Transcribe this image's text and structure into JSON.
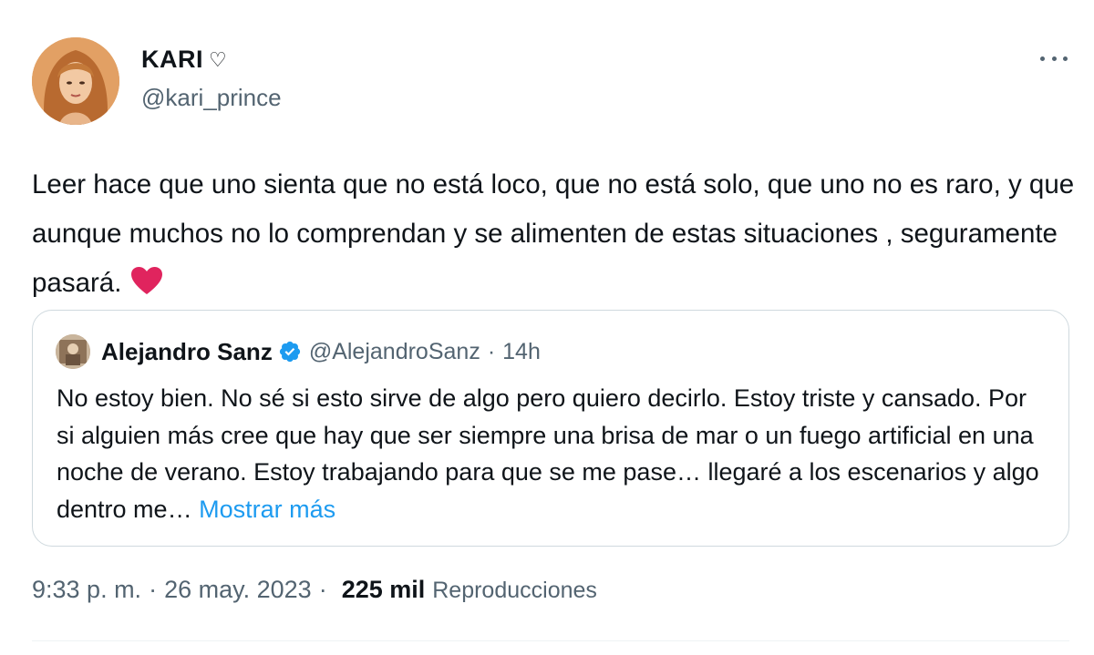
{
  "author": {
    "display_name": "KARI",
    "name_symbol": "♡",
    "handle": "@kari_prince",
    "avatar_icon": "profile-photo"
  },
  "more_icon": "more-horizontal-icon",
  "tweet": {
    "text": "Leer hace que uno sienta que no está loco, que no está solo, que uno no es raro, y que aunque muchos no lo comprendan y se alimenten de estas situaciones , seguramente pasará.",
    "emoji": "red-heart",
    "emoji_color": "#e0245e"
  },
  "quote": {
    "display_name": "Alejandro Sanz",
    "verified": true,
    "verified_color": "#1d9bf0",
    "handle": "@AlejandroSanz",
    "separator": "·",
    "time": "14h",
    "text": "No estoy bien. No sé si esto sirve de algo pero quiero decirlo. Estoy triste y cansado. Por si alguien más cree que hay que ser siempre una brisa de mar o un fuego artificial en una noche de verano. Estoy trabajando para que se me pase… llegaré a los escenarios y algo dentro me…",
    "show_more": "Mostrar más"
  },
  "meta": {
    "time": "9:33 p. m.",
    "separator": "·",
    "date": "26 may. 2023",
    "separator2": "·",
    "views_count": "225 mil",
    "views_label": "Reproducciones"
  },
  "colors": {
    "text_primary": "#0f1419",
    "text_secondary": "#536471",
    "link": "#1d9bf0",
    "border": "#cfd9de"
  }
}
